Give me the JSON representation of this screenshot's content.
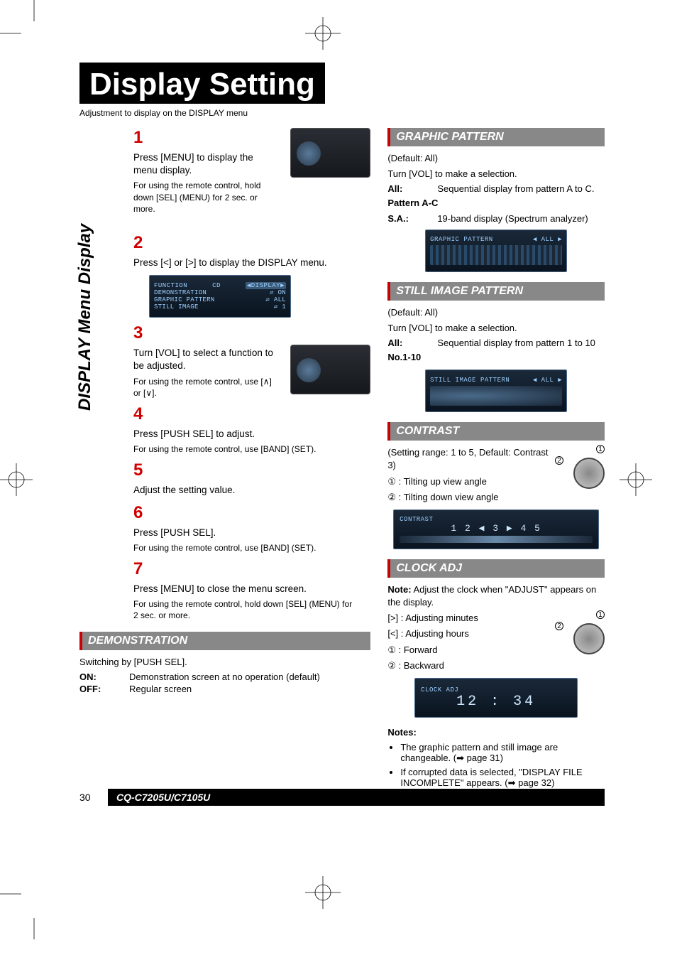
{
  "page_title": "Display Setting",
  "page_subtitle": "Adjustment to display on the DISPLAY menu",
  "sidebar_label": "DISPLAY Menu Display",
  "steps": [
    {
      "num": "1",
      "text": "Press [MENU] to display the menu display.",
      "note": "For using the remote control, hold down [SEL] (MENU) for 2 sec. or more."
    },
    {
      "num": "2",
      "text": "Press [<] or [>] to display the DISPLAY menu."
    },
    {
      "num": "3",
      "text": "Turn [VOL] to select a function to be adjusted.",
      "note": "For using the remote control, use [∧] or [∨]."
    },
    {
      "num": "4",
      "text": "Press [PUSH SEL] to adjust.",
      "note": "For using the remote control, use [BAND] (SET)."
    },
    {
      "num": "5",
      "text": "Adjust the setting value."
    },
    {
      "num": "6",
      "text": "Press [PUSH SEL].",
      "note": "For using the remote control, use [BAND] (SET)."
    },
    {
      "num": "7",
      "text": "Press [MENU] to close the menu screen.",
      "note": "For using the remote control, hold down [SEL] (MENU) for 2 sec. or more."
    }
  ],
  "lcd_menu": {
    "tabs_left": "FUNCTION",
    "tabs_mid": "CD",
    "tabs_right": "◀DISPLAY▶",
    "rows": [
      {
        "label": "DEMONSTRATION",
        "value": "⇌ ON"
      },
      {
        "label": "GRAPHIC PATTERN",
        "value": "⇌ ALL"
      },
      {
        "label": "STILL IMAGE",
        "value": "⇌ 1"
      }
    ]
  },
  "demonstration": {
    "title": "DEMONSTRATION",
    "intro": "Switching by [PUSH SEL].",
    "on": {
      "term": "ON:",
      "def": "Demonstration screen at no operation (default)"
    },
    "off": {
      "term": "OFF:",
      "def": "Regular screen"
    }
  },
  "graphic_pattern": {
    "title": "GRAPHIC PATTERN",
    "default": "(Default: All)",
    "instr": "Turn [VOL] to make a selection.",
    "all": {
      "term": "All:",
      "def": "Sequential display from pattern A to C."
    },
    "row2_heading": "Pattern A-C",
    "sa": {
      "term": "S.A.:",
      "def": "19-band display (Spectrum analyzer)"
    },
    "display_title": "GRAPHIC PATTERN",
    "display_value": "◀ ALL ▶"
  },
  "still_image": {
    "title": "STILL IMAGE PATTERN",
    "default": "(Default: All)",
    "instr": "Turn [VOL] to make a selection.",
    "all": {
      "term": "All:",
      "def": "Sequential display from pattern 1 to 10"
    },
    "row2_heading": "No.1-10",
    "display_title": "STILL IMAGE PATTERN",
    "display_value": "◀ ALL ▶"
  },
  "contrast": {
    "title": "CONTRAST",
    "range": "(Setting range: 1 to 5, Default: Contrast 3)",
    "opt1": "① : Tilting up view angle",
    "opt2": "② : Tilting down view angle",
    "display_title": "CONTRAST",
    "display_vals": "1    2   ◀ 3 ▶   4    5"
  },
  "clock": {
    "title": "CLOCK ADJ",
    "note_lead": "Note:",
    "note_text": " Adjust the clock when \"ADJUST\" appears on the display.",
    "r1": "[>] :  Adjusting minutes",
    "r2": "[<] :  Adjusting hours",
    "r3": "① :   Forward",
    "r4": "② :   Backward",
    "display_title": "CLOCK ADJ",
    "display_time": "12 : 34"
  },
  "notes": {
    "heading": "Notes:",
    "n1": "The graphic pattern and still image are changeable. (➡ page 31)",
    "n2": "If corrupted data is selected, \"DISPLAY FILE INCOMPLETE\" appears. (➡ page 32)"
  },
  "page_number": "30",
  "model": "CQ-C7205U/C7105U"
}
